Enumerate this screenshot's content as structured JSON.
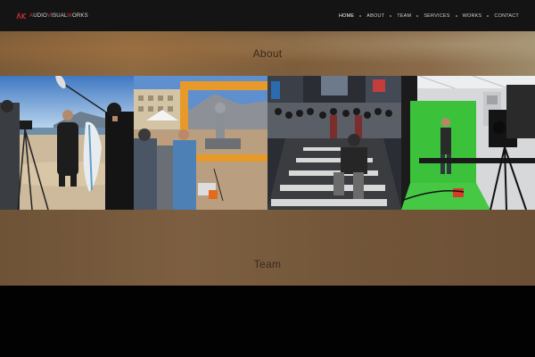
{
  "brand": {
    "logo_prefix": "K",
    "logo_parts": [
      "UDIO",
      "V",
      "ISUAL",
      "W",
      "ORKS"
    ],
    "logo_initials": [
      "A",
      "V",
      "W"
    ]
  },
  "nav": {
    "items": [
      {
        "label": "HOME",
        "active": true
      },
      {
        "label": "ABOUT",
        "active": false
      },
      {
        "label": "TEAM",
        "active": false
      },
      {
        "label": "SERVICES",
        "active": false
      },
      {
        "label": "WORKS",
        "active": false
      },
      {
        "label": "CONTACT",
        "active": false
      }
    ]
  },
  "about": {
    "title": "About"
  },
  "team": {
    "title": "Team"
  },
  "colors": {
    "nav_bg": "#141414",
    "accent": "#e0323a",
    "section_text": "#3a2a1c"
  }
}
